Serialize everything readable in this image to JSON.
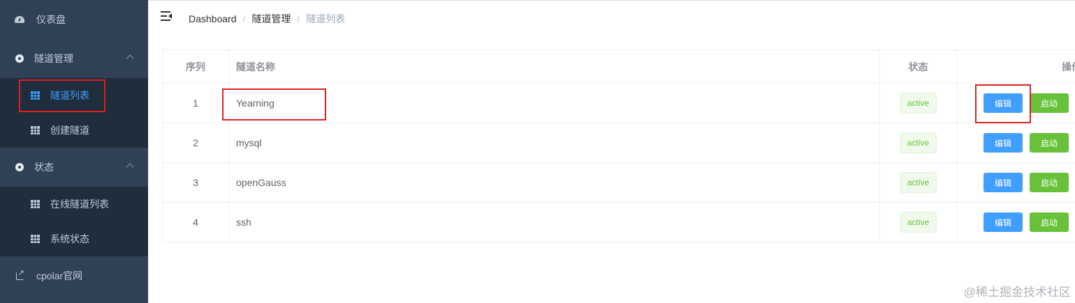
{
  "sidebar": {
    "dashboard": "仪表盘",
    "tunnel_group": "隧道管理",
    "tunnel_list": "隧道列表",
    "create_tunnel": "创建隧道",
    "status_group": "状态",
    "online_tunnels": "在线隧道列表",
    "system_status": "系统状态",
    "cpolar_site": "cpolar官网"
  },
  "breadcrumb": [
    "Dashboard",
    "隧道管理",
    "隧道列表"
  ],
  "table": {
    "headers": {
      "index": "序列",
      "name": "隧道名称",
      "status": "状态",
      "ops": "操作"
    },
    "rows": [
      {
        "index": "1",
        "name": "Yearning",
        "status": "active",
        "edit": "编辑",
        "start": "启动"
      },
      {
        "index": "2",
        "name": "mysql",
        "status": "active",
        "edit": "编辑",
        "start": "启动"
      },
      {
        "index": "3",
        "name": "openGauss",
        "status": "active",
        "edit": "编辑",
        "start": "启动"
      },
      {
        "index": "4",
        "name": "ssh",
        "status": "active",
        "edit": "编辑",
        "start": "启动"
      }
    ]
  },
  "watermark": "@稀土掘金技术社区",
  "colors": {
    "sidebar_bg": "#304156",
    "submenu_bg": "#1f2d3d",
    "accent": "#409eff",
    "success": "#67c23a",
    "highlight": "#e02020"
  }
}
